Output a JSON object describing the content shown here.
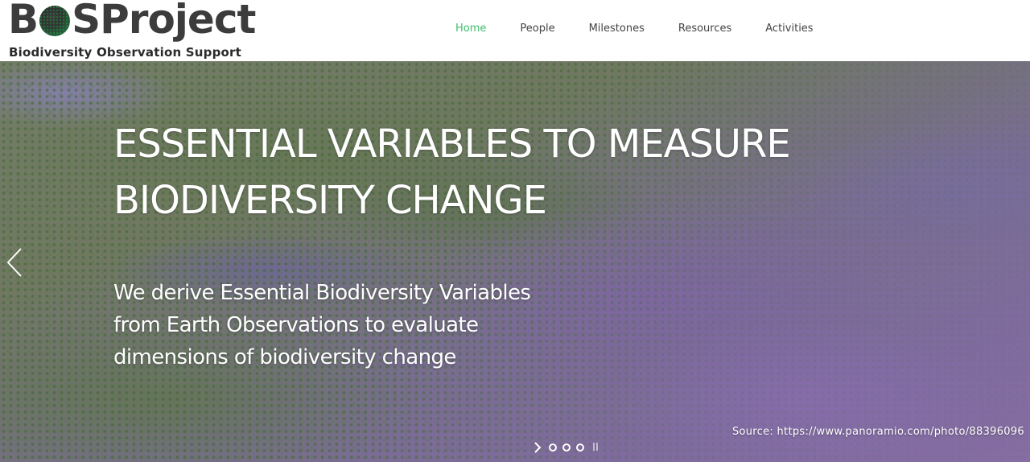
{
  "logo": {
    "word_prefix": "B",
    "word_suffix": "SProject",
    "tagline": "Biodiversity Observation Support"
  },
  "nav": {
    "items": [
      {
        "label": "Home",
        "active": true
      },
      {
        "label": "People",
        "active": false
      },
      {
        "label": "Milestones",
        "active": false
      },
      {
        "label": "Resources",
        "active": false
      },
      {
        "label": "Activities",
        "active": false
      }
    ],
    "active_color": "#3fbf6a"
  },
  "hero": {
    "heading_line1": "ESSENTIAL VARIABLES TO MEASURE",
    "heading_line2": "BIODIVERSITY CHANGE",
    "body_line1": "We derive Essential Biodiversity Variables",
    "body_line2": "from Earth Observations to evaluate",
    "body_line3": "dimensions of biodiversity change",
    "source": "Source: https://www.panoramio.com/photo/88396096",
    "prev_icon": "chevron-left-icon",
    "next_icon": "chevron-right-icon",
    "slide_count": 3
  }
}
